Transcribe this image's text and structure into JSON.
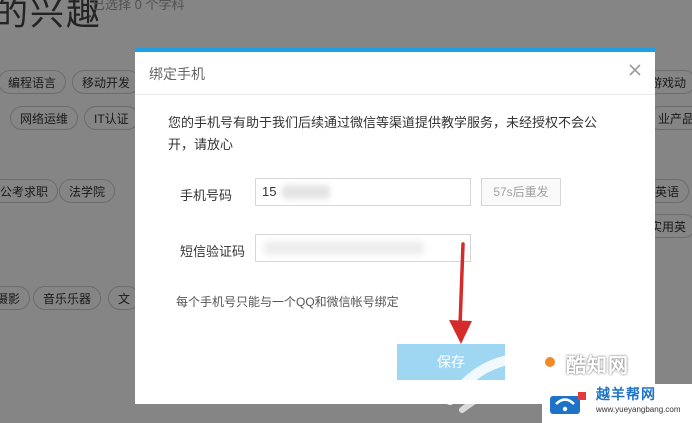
{
  "background": {
    "title_fragment": "的兴趣",
    "count_fragment": "已选择 0 个学科",
    "chips": [
      "编程语言",
      "移动开发",
      "游戏动",
      "网络运维",
      "IT认证",
      "业产品",
      "公考求职",
      "法学院",
      "英语",
      "实用英",
      "摄影",
      "音乐乐器",
      "文"
    ]
  },
  "dialog": {
    "title": "绑定手机",
    "close_glyph": "×",
    "info": "您的手机号有助于我们后续通过微信等渠道提供教学服务，未经授权不会公开，请放心",
    "phone_label": "手机号码",
    "phone_value": "15",
    "resend_label": "57s后重发",
    "code_label": "短信验证码",
    "code_value": "",
    "note": "每个手机号只能与一个QQ和微信帐号绑定",
    "save_label": "保存"
  },
  "watermarks": {
    "logo_text": "酷知网",
    "site_name_cn": "越羊帮网",
    "site_url": "www.yueyangbang.com"
  },
  "colors": {
    "accent": "#1ea0e6",
    "save_button": "#9fd7f3",
    "annotation_arrow": "#d62b2b"
  }
}
